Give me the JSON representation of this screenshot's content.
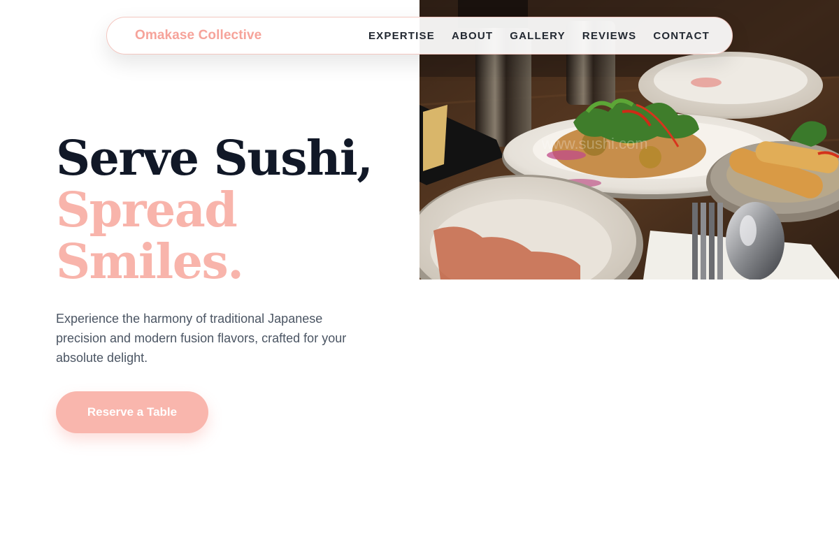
{
  "brand": {
    "name": "Omakase Collective"
  },
  "nav": {
    "links": [
      "EXPERTISE",
      "ABOUT",
      "GALLERY",
      "REVIEWS",
      "CONTACT"
    ]
  },
  "hero": {
    "headline_line1": "Serve Sushi,",
    "headline_line2": "Spread",
    "headline_line3": "Smiles.",
    "subtitle": "Experience the harmony of traditional Japanese precision and modern fusion flavors, crafted for your absolute delight.",
    "cta_label": "Reserve a Table",
    "photo_watermark": "www.sushi.com"
  },
  "colors": {
    "accent_pink": "#f8b4ab",
    "brand_pink": "#f6a39a",
    "heading_dark": "#111827",
    "body_gray": "#4b5563"
  }
}
